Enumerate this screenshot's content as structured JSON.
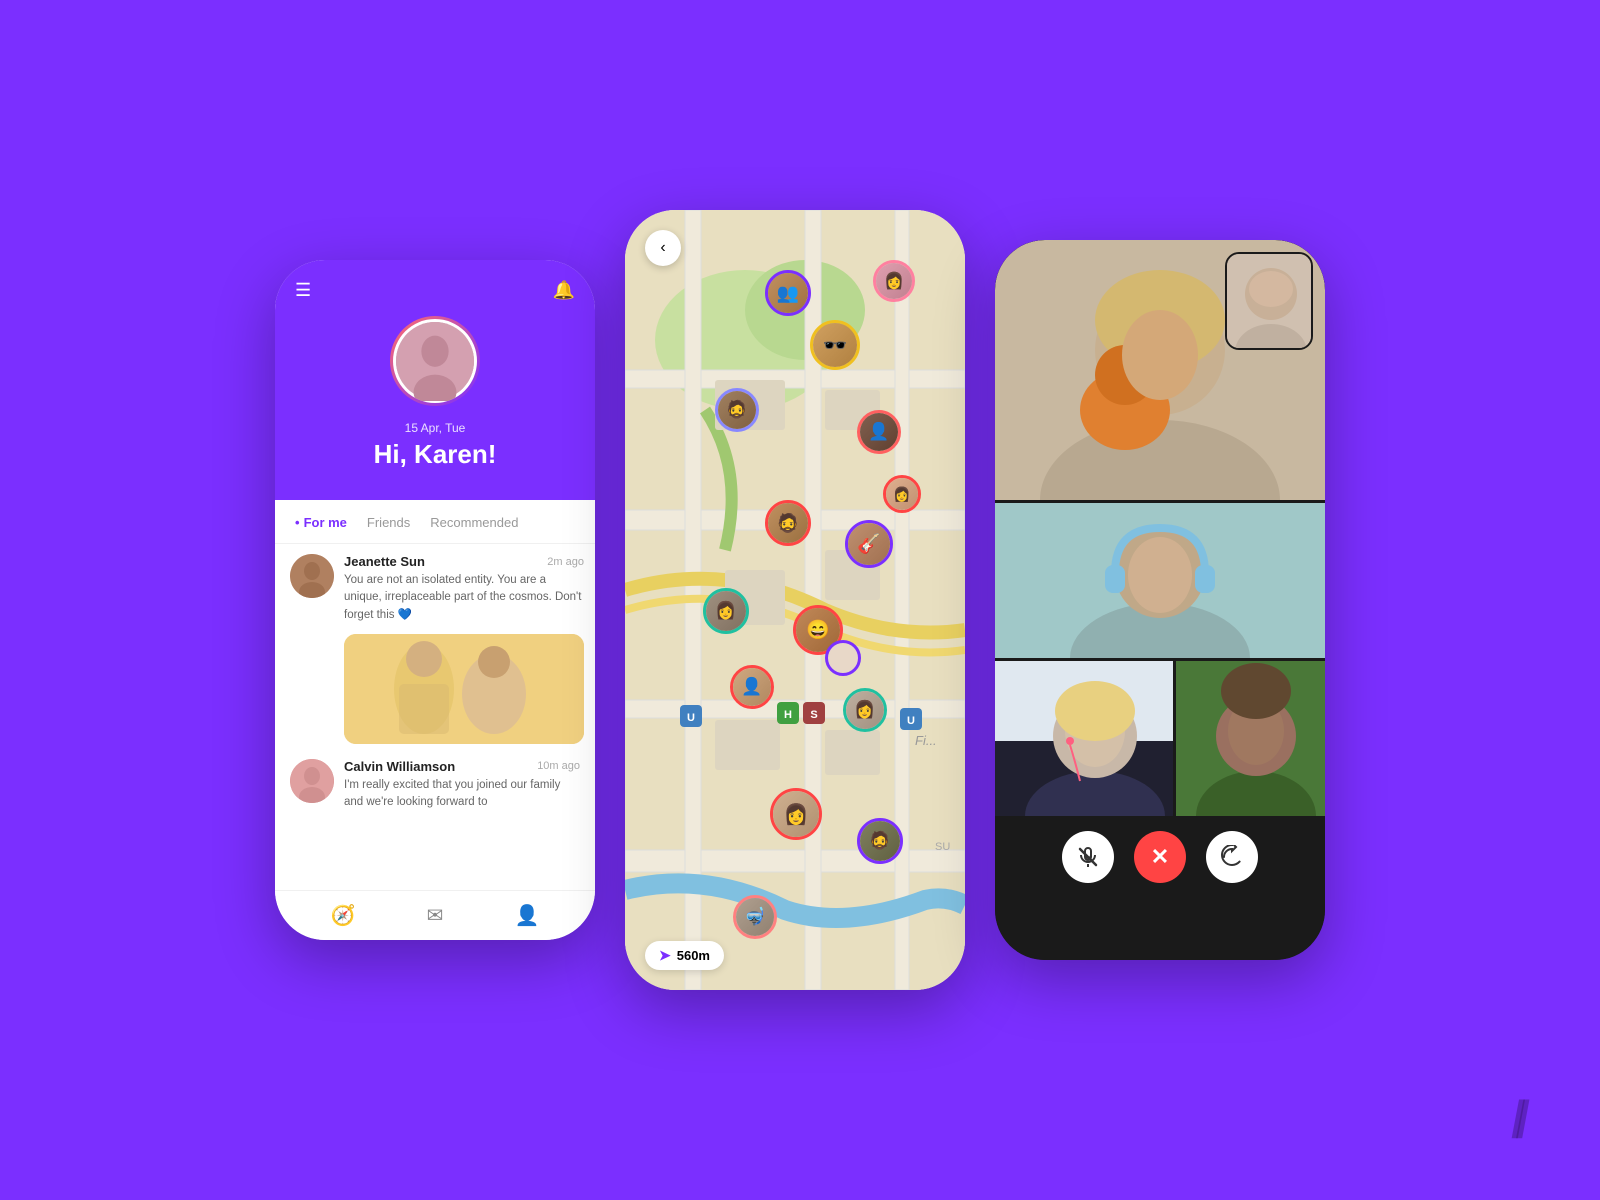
{
  "background_color": "#7B2FFF",
  "phone1": {
    "header": {
      "date": "15 Apr, Tue",
      "greeting": "Hi, Karen!"
    },
    "tabs": [
      {
        "label": "For me",
        "active": true
      },
      {
        "label": "Friends",
        "active": false
      },
      {
        "label": "Recommended",
        "active": false
      }
    ],
    "feed": [
      {
        "name": "Jeanette Sun",
        "time": "2m ago",
        "text": "You are not an isolated entity. You are a unique, irreplaceable part of the cosmos. Don't forget this 💙",
        "has_image": true
      },
      {
        "name": "Calvin Williamson",
        "time": "10m ago",
        "text": "I'm really excited that you joined our family and we're looking forward to",
        "has_image": false
      }
    ]
  },
  "phone2": {
    "back_label": "‹",
    "distance_label": "560m",
    "distance_icon": "➤",
    "su_label": "SU"
  },
  "phone3": {
    "controls": {
      "mute_icon": "🎤",
      "end_icon": "✕",
      "flip_icon": "🔄"
    }
  },
  "brand": {
    "slash": "//"
  }
}
